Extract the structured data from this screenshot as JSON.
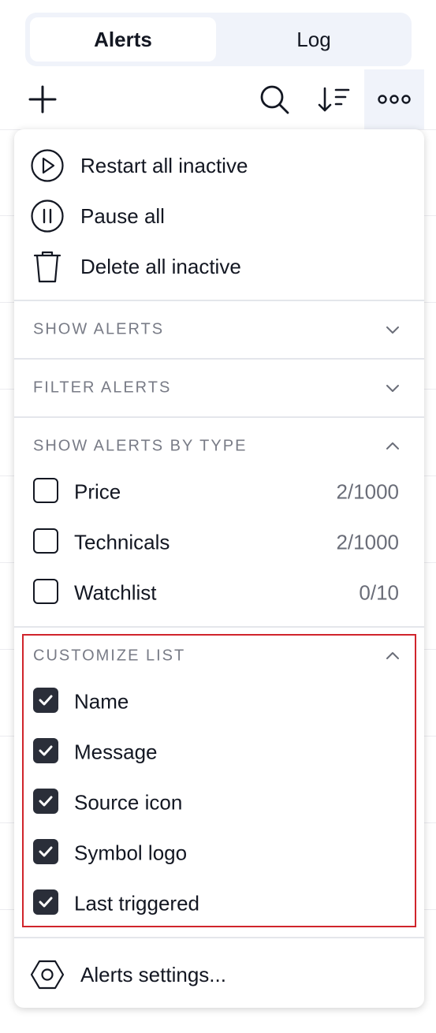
{
  "tabs": [
    {
      "label": "Alerts",
      "active": true
    },
    {
      "label": "Log",
      "active": false
    }
  ],
  "toolbar": {
    "icons": [
      "plus-icon",
      "search-icon",
      "sort-icon",
      "more-dots-icon"
    ]
  },
  "menu": {
    "actions": [
      {
        "label": "Restart all inactive",
        "icon": "play-circle-icon"
      },
      {
        "label": "Pause all",
        "icon": "pause-circle-icon"
      },
      {
        "label": "Delete all inactive",
        "icon": "trash-icon"
      }
    ],
    "sections": {
      "show_alerts": {
        "title": "SHOW ALERTS",
        "expanded": false
      },
      "filter_alerts": {
        "title": "FILTER ALERTS",
        "expanded": false
      },
      "by_type": {
        "title": "SHOW ALERTS BY TYPE",
        "expanded": true,
        "items": [
          {
            "label": "Price",
            "count": "2/1000",
            "checked": false
          },
          {
            "label": "Technicals",
            "count": "2/1000",
            "checked": false
          },
          {
            "label": "Watchlist",
            "count": "0/10",
            "checked": false
          }
        ]
      },
      "customize": {
        "title": "CUSTOMIZE LIST",
        "expanded": true,
        "items": [
          {
            "label": "Name",
            "checked": true
          },
          {
            "label": "Message",
            "checked": true
          },
          {
            "label": "Source icon",
            "checked": true
          },
          {
            "label": "Symbol logo",
            "checked": true
          },
          {
            "label": "Last triggered",
            "checked": true
          }
        ]
      }
    },
    "settings": {
      "label": "Alerts settings...",
      "icon": "hexagon-settings-icon"
    }
  },
  "colors": {
    "text": "#131722",
    "muted": "#787b86",
    "checkbox_fill": "#2a2e39",
    "highlight": "#d0242b",
    "tab_bg": "#f0f3fa"
  }
}
